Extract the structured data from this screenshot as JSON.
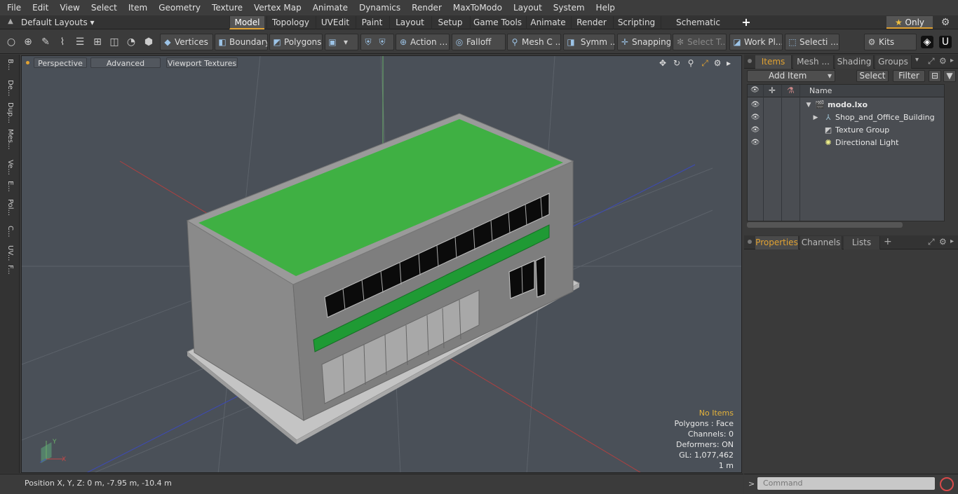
{
  "menu": [
    "File",
    "Edit",
    "View",
    "Select",
    "Item",
    "Geometry",
    "Texture",
    "Vertex Map",
    "Animate",
    "Dynamics",
    "Render",
    "MaxToModo",
    "Layout",
    "System",
    "Help"
  ],
  "layouts_label": "Default Layouts",
  "layout_tabs": [
    "Model",
    "Topology",
    "UVEdit",
    "Paint",
    "Layout",
    "Setup",
    "Game Tools",
    "Animate",
    "Render",
    "Scripting",
    "Schematic Fusion"
  ],
  "active_layout_tab": "Model",
  "only_label": "Only",
  "toolbar": {
    "vertices": "Vertices",
    "boundary": "Boundary",
    "polygons": "Polygons",
    "action": "Action",
    "falloff": "Falloff",
    "mesh": "Mesh C ...",
    "symm": "Symm ...",
    "snapping": "Snapping",
    "select_t": "Select T...",
    "work_pl": "Work Pl...",
    "selecti": "Selecti ...",
    "kits": "Kits"
  },
  "left_strip": [
    "B...",
    "De...",
    "Dup...",
    "Mes...",
    "Ve...",
    "E...",
    "Pol...",
    "C...",
    "UV...",
    "F..."
  ],
  "viewport": {
    "perspective": "Perspective",
    "advanced": "Advanced",
    "viewport_textures": "Viewport Textures",
    "info": {
      "no_items": "No Items",
      "polygons": "Polygons : Face",
      "channels": "Channels: 0",
      "deformers": "Deformers: ON",
      "gl": "GL: 1,077,462",
      "scale": "1 m"
    }
  },
  "items_panel": {
    "tabs": [
      "Items",
      "Mesh ...",
      "Shading",
      "Groups"
    ],
    "active_tab": "Items",
    "add_item": "Add Item",
    "select": "Select",
    "filter": "Filter",
    "name_header": "Name",
    "tree": [
      {
        "label": "modo.lxo",
        "bold": true
      },
      {
        "label": "Shop_and_Office_Building"
      },
      {
        "label": "Texture Group"
      },
      {
        "label": "Directional Light"
      }
    ]
  },
  "properties_panel": {
    "tabs": [
      "Properties",
      "Channels",
      "Lists"
    ],
    "active_tab": "Properties"
  },
  "status": {
    "position": "Position X, Y, Z:   0 m, -7.95 m, -10.4 m"
  },
  "command": {
    "prompt": ">",
    "placeholder": "Command"
  },
  "colors": {
    "accent": "#e1a232",
    "roof_green": "#3fb043",
    "stripe_green": "#1f9a34",
    "building_gray": "#8a8a8a",
    "viewport_bg": "#4a5058"
  }
}
